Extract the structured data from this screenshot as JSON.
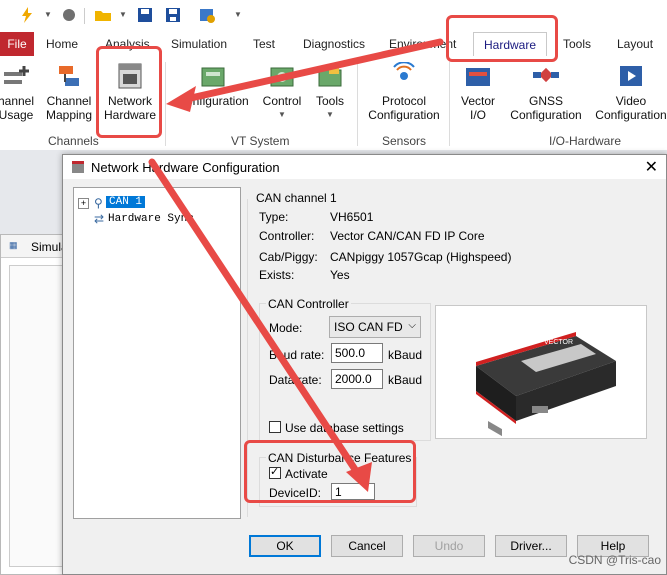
{
  "colors": {
    "file_tab": "#c0282f",
    "annotation_red": "#e84a46",
    "focus_blue": "#0078d7"
  },
  "ribbon_tabs": [
    "File",
    "Home",
    "Analysis",
    "Simulation",
    "Test",
    "Diagnostics",
    "Environment",
    "Hardware",
    "Tools",
    "Layout"
  ],
  "ribbon_buttons": {
    "channel_usage": "hannel\nUsage",
    "channel_mapping": "Channel\nMapping",
    "network_hardware": "Network\nHardware",
    "configuration": "Configuration",
    "control": "Control",
    "tools": "Tools",
    "protocol_configuration": "Protocol\nConfiguration",
    "vector_io": "Vector\nI/O",
    "gnss_configuration": "GNSS\nConfiguration",
    "video_configuration": "Video\nConfiguration"
  },
  "ribbon_groups": {
    "channels": "Channels",
    "vt_system": "VT System",
    "sensors": "Sensors",
    "io_hardware": "I/O-Hardware"
  },
  "background": {
    "sim_window_title": "Simula"
  },
  "dialog": {
    "title": "Network Hardware Configuration",
    "tree": [
      "CAN 1",
      "Hardware Sync"
    ],
    "channel_header": "CAN channel 1",
    "info": [
      {
        "label": "Type:",
        "value": "VH6501"
      },
      {
        "label": "Controller:",
        "value": "Vector CAN/CAN FD IP Core"
      },
      {
        "label": "Cab/Piggy:",
        "value": "CANpiggy 1057Gcap (Highspeed)"
      },
      {
        "label": "Exists:",
        "value": "Yes"
      }
    ],
    "controller": {
      "legend": "CAN Controller",
      "mode_label": "Mode:",
      "mode_value": "ISO CAN FD",
      "baud_label": "Baud rate:",
      "baud_value": "500.0",
      "baud_unit": "kBaud",
      "data_label": "Data rate:",
      "data_value": "2000.0",
      "data_unit": "kBaud",
      "use_db": "Use database settings"
    },
    "device_brand": "VECTOR",
    "disturbance": {
      "legend": "CAN Disturbance Features",
      "activate": "Activate",
      "device_label": "DeviceID:",
      "device_value": "1"
    },
    "buttons": {
      "ok": "OK",
      "cancel": "Cancel",
      "undo": "Undo",
      "driver": "Driver...",
      "help": "Help"
    }
  },
  "watermark": "CSDN @Tris-cao"
}
